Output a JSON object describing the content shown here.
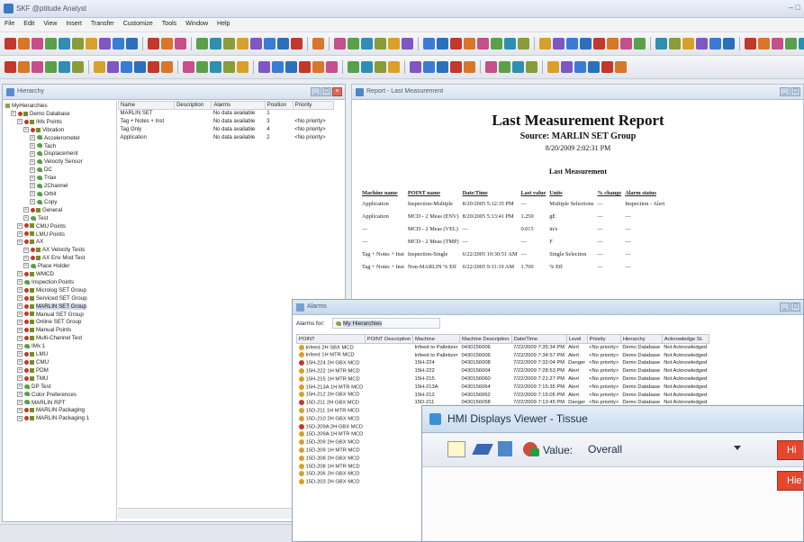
{
  "window": {
    "title": "SKF @ptitude Analyst",
    "controls": "– □"
  },
  "menu": [
    "File",
    "Edit",
    "View",
    "Insert",
    "Transfer",
    "Customize",
    "Tools",
    "Window",
    "Help"
  ],
  "hierarchy": {
    "title": "Hierarchy",
    "root": "MyHierarchies",
    "tree": [
      {
        "t": "Demo Database",
        "lvl": 0,
        "icon": "db"
      },
      {
        "t": "IMx Points",
        "lvl": 1,
        "icon": "db"
      },
      {
        "t": "Vibration",
        "lvl": 2,
        "icon": "db"
      },
      {
        "t": "Accelerometer",
        "lvl": 3,
        "icon": "pin"
      },
      {
        "t": "Tach",
        "lvl": 3,
        "icon": "pin"
      },
      {
        "t": "Displacement",
        "lvl": 3,
        "icon": "pin"
      },
      {
        "t": "Velocity Sensor",
        "lvl": 3,
        "icon": "pin"
      },
      {
        "t": "DC",
        "lvl": 3,
        "icon": "pin"
      },
      {
        "t": "Triax",
        "lvl": 3,
        "icon": "pin"
      },
      {
        "t": "2Channel",
        "lvl": 3,
        "icon": "pin"
      },
      {
        "t": "Orbit",
        "lvl": 3,
        "icon": "pin"
      },
      {
        "t": "Copy",
        "lvl": 3,
        "icon": "pin"
      },
      {
        "t": "General",
        "lvl": 2,
        "icon": "db"
      },
      {
        "t": "Test",
        "lvl": 2,
        "icon": "pin"
      },
      {
        "t": "CMU Points",
        "lvl": 1,
        "icon": "db"
      },
      {
        "t": "LMU Points",
        "lvl": 1,
        "icon": "db"
      },
      {
        "t": "AX",
        "lvl": 1,
        "icon": "db"
      },
      {
        "t": "AX Velocity Tests",
        "lvl": 2,
        "icon": "db"
      },
      {
        "t": "AX Env Mod Test",
        "lvl": 2,
        "icon": "db"
      },
      {
        "t": "Place Holder",
        "lvl": 2,
        "icon": "pin"
      },
      {
        "t": "WMCD",
        "lvl": 1,
        "icon": "db"
      },
      {
        "t": "Inspection Points",
        "lvl": 1,
        "icon": "pin"
      },
      {
        "t": "Microlog SET Group",
        "lvl": 1,
        "icon": "db"
      },
      {
        "t": "Serviced SET Group",
        "lvl": 1,
        "icon": "db"
      },
      {
        "t": "MARLIN SET Group",
        "lvl": 1,
        "icon": "db",
        "sel": true
      },
      {
        "t": "Manual SET Group",
        "lvl": 1,
        "icon": "db"
      },
      {
        "t": "Online SET Group",
        "lvl": 1,
        "icon": "db"
      },
      {
        "t": "Manual Points",
        "lvl": 1,
        "icon": "db"
      },
      {
        "t": "Multi-Channel Test",
        "lvl": 1,
        "icon": "db"
      },
      {
        "t": "IMx 1",
        "lvl": 1,
        "icon": "pin"
      },
      {
        "t": "LMU",
        "lvl": 1,
        "icon": "db"
      },
      {
        "t": "CMU",
        "lvl": 1,
        "icon": "db"
      },
      {
        "t": "PDM",
        "lvl": 1,
        "icon": "db"
      },
      {
        "t": "TMU",
        "lvl": 1,
        "icon": "db"
      },
      {
        "t": "DP Test",
        "lvl": 1,
        "icon": "pin"
      },
      {
        "t": "Color Preferences",
        "lvl": 1,
        "icon": "pin"
      },
      {
        "t": "MARLIN RPT",
        "lvl": 1,
        "icon": "pin"
      },
      {
        "t": "MARLIN Packaging",
        "lvl": 1,
        "icon": "db"
      },
      {
        "t": "MARLIN Packaging 1",
        "lvl": 1,
        "icon": "db"
      }
    ],
    "grid_headers": [
      "Name",
      "Description",
      "Alarms",
      "Position",
      "Priority"
    ],
    "grid_rows": [
      [
        "MARLIN SET",
        "",
        "No data available",
        "1",
        ""
      ],
      [
        "Tag + Notes + Inst",
        "",
        "No data available",
        "3",
        "<No priority>"
      ],
      [
        "Tag Only",
        "",
        "No data available",
        "4",
        "<No priority>"
      ],
      [
        "Application",
        "",
        "No data available",
        "2",
        "<No priority>"
      ]
    ]
  },
  "report": {
    "window_title": "Report - Last Measurement",
    "heading": "Last Measurement Report",
    "source": "Source: MARLIN SET Group",
    "date": "8/20/2009 2:02:31 PM",
    "section": "Last Measurement",
    "headers": [
      "Machine name",
      "POINT name",
      "Date/Time",
      "Last value",
      "Units",
      "% change",
      "Alarm status"
    ],
    "rows": [
      [
        "Application",
        "Inspection-Multiple",
        "8/20/2005 5:12:35 PM",
        "—",
        "Multiple Selections",
        "—",
        "Inspection - Alert"
      ],
      [
        "Application",
        "MCD - 2 Meas (ENV)",
        "8/20/2005 5:13:41 PM",
        "1.250",
        "gE",
        "—",
        "—"
      ],
      [
        "—",
        "MCD - 2 Meas (VEL)",
        "—",
        "0.015",
        "in/s",
        "—",
        "—"
      ],
      [
        "—",
        "MCD - 2 Meas (TMP)",
        "—",
        "—",
        "F",
        "—",
        "—"
      ],
      [
        "Tag + Notes + Inst",
        "Inspection-Single",
        "6/22/2005 10:30:51 AM",
        "—",
        "Single Selection",
        "—",
        "—"
      ],
      [
        "Tag + Notes + Inst",
        "Non-MARLIN % Eff",
        "6/22/2005 9:11:19 AM",
        "1.700",
        "% Eff",
        "—",
        "—"
      ]
    ]
  },
  "alarms": {
    "window_title": "Alarms",
    "alarms_for_label": "Alarms for:",
    "alarms_for_value": "My Hierarchies",
    "headers": [
      "POINT",
      "POINT Description",
      "Machine",
      "Machine Description",
      "Date/Time",
      "Level",
      "Priority",
      "Hierarchy",
      "Acknowledge St."
    ],
    "rows": [
      [
        "Infeed 2H SBX MCD",
        "",
        "Infeed to Palletizer",
        "0430156006",
        "7/22/2009 7:35:34 PM",
        "Alert",
        "<No priority>",
        "Demo Database",
        "Not Acknowledged"
      ],
      [
        "Infeed 1H MTR MCD",
        "",
        "Infeed to Palletizer",
        "0430156006",
        "7/22/2009 7:34:57 PM",
        "Alert",
        "<No priority>",
        "Demo Database",
        "Not Acknowledged"
      ],
      [
        "15H-224 2H GBX MCD",
        "",
        "15H-224",
        "0430156008",
        "7/22/2009 7:32:04 PM",
        "Danger",
        "<No priority>",
        "Demo Database",
        "Not Acknowledged"
      ],
      [
        "15H-222 1H MTR MCD",
        "",
        "15H-222",
        "0430156004",
        "7/22/2009 7:28:53 PM",
        "Alert",
        "<No priority>",
        "Demo Database",
        "Not Acknowledged"
      ],
      [
        "15H-215 1H MTR MCD",
        "",
        "15H-215",
        "0430156060",
        "7/22/2009 7:21:27 PM",
        "Alert",
        "<No priority>",
        "Demo Database",
        "Not Acknowledged"
      ],
      [
        "15H-213A 1H MTR MCD",
        "",
        "15H-213A",
        "0430156064",
        "7/22/2009 7:15:35 PM",
        "Alert",
        "<No priority>",
        "Demo Database",
        "Not Acknowledged"
      ],
      [
        "15H-212 2H GBX MCD",
        "",
        "15H-212",
        "0430156062",
        "7/22/2009 7:15:05 PM",
        "Alert",
        "<No priority>",
        "Demo Database",
        "Not Acknowledged"
      ],
      [
        "15D-211 2H GBX MCD",
        "",
        "15D-211",
        "0430156058",
        "7/22/2009 7:13:45 PM",
        "Danger",
        "<No priority>",
        "Demo Database",
        "Not Acknowledged"
      ],
      [
        "15D-211 1H MTR MCD",
        "",
        "",
        "",
        "",
        "",
        "",
        "",
        ""
      ],
      [
        "15D-210 2H GBX MCD",
        "",
        "",
        "",
        "",
        "",
        "",
        "",
        ""
      ],
      [
        "15D-209A 2H GBX MCD",
        "",
        "",
        "",
        "",
        "",
        "",
        "",
        ""
      ],
      [
        "15D-209A 1H MTR MCD",
        "",
        "",
        "",
        "",
        "",
        "",
        "",
        ""
      ],
      [
        "15D-209 2H GBX MCD",
        "",
        "",
        "",
        "",
        "",
        "",
        "",
        ""
      ],
      [
        "15D-209 1H MTR MCD",
        "",
        "",
        "",
        "",
        "",
        "",
        "",
        ""
      ],
      [
        "15D-208 2H GBX MCD",
        "",
        "",
        "",
        "",
        "",
        "",
        "",
        ""
      ],
      [
        "15D-208 1H MTR MCD",
        "",
        "",
        "",
        "",
        "",
        "",
        "",
        ""
      ],
      [
        "15D-206 2H GBX MCD",
        "",
        "",
        "",
        "",
        "",
        "",
        "",
        ""
      ],
      [
        "15D-203 2H GBX MCD",
        "",
        "",
        "",
        "",
        "",
        "",
        "",
        ""
      ]
    ]
  },
  "hmi": {
    "title": "HMI Displays Viewer - Tissue",
    "value_label": "Value:",
    "value_selected": "Overall",
    "btn1": "Hi",
    "btn2": "Hie"
  }
}
